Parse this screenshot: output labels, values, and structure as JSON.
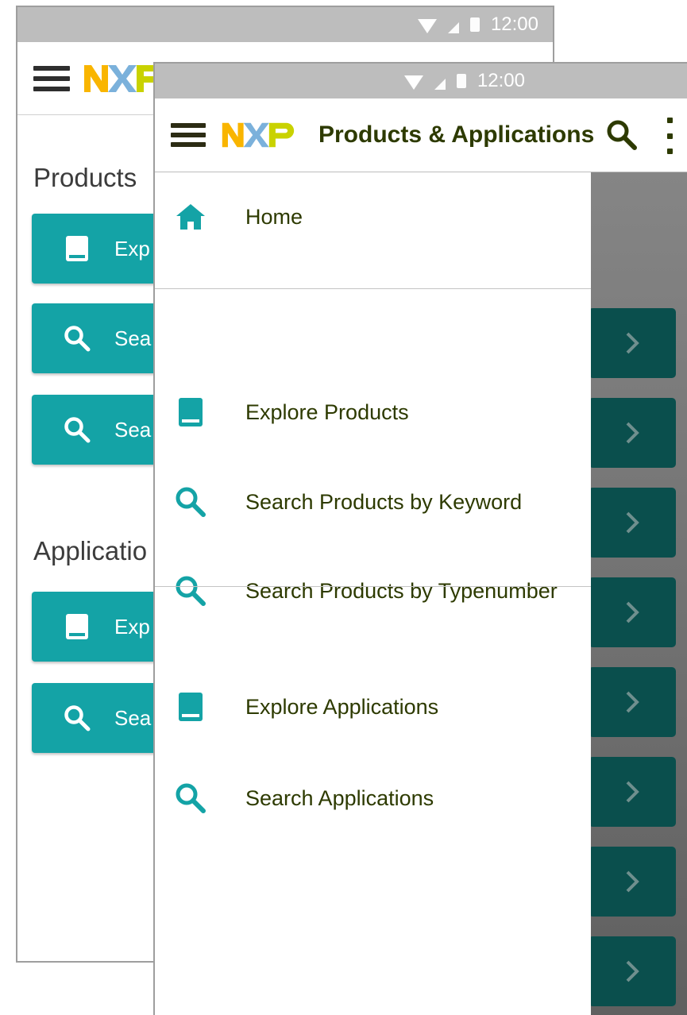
{
  "status_bar": {
    "time": "12:00"
  },
  "back_screen": {
    "logo_text": "NXP",
    "products_heading": "Products",
    "applications_heading": "Applicatio",
    "buttons": [
      {
        "label": "Exp",
        "icon": "book-icon"
      },
      {
        "label": "Sea",
        "icon": "search-icon"
      },
      {
        "label": "Sea",
        "icon": "search-icon"
      },
      {
        "label": "Exp",
        "icon": "book-icon"
      },
      {
        "label": "Sea",
        "icon": "search-icon"
      }
    ]
  },
  "front_screen": {
    "logo_text": "NXP",
    "title": "Products & Applications",
    "actions": [
      "search-icon",
      "more-vert-icon"
    ],
    "drawer": {
      "items": [
        {
          "label": "Home",
          "icon": "home-icon"
        },
        {
          "label": "Explore Products",
          "icon": "book-icon"
        },
        {
          "label": "Search Products by Keyword",
          "icon": "search-icon"
        },
        {
          "label": "Search Products by Typenumber",
          "icon": "search-icon"
        },
        {
          "label": "Explore Applications",
          "icon": "book-icon"
        },
        {
          "label": "Search Applications",
          "icon": "search-icon"
        }
      ]
    },
    "background_chevron_buttons": 8
  },
  "colors": {
    "teal": "#14a3a6",
    "dark_teal": "#0a4f4d",
    "text_olive": "#2d3a00",
    "status_bar": "#bdbdbd"
  }
}
